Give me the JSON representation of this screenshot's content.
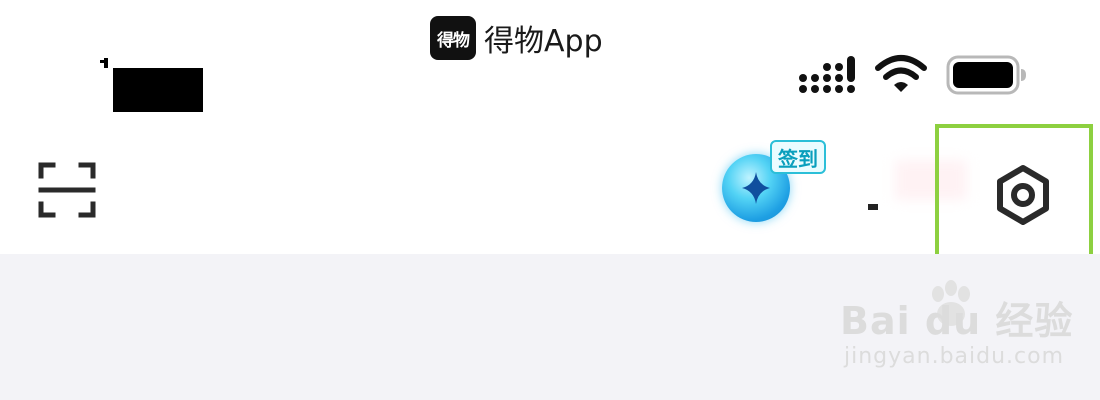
{
  "app_label": {
    "logo_text": "得物",
    "name": "得物App"
  },
  "status_bar": {
    "signal": "signal-icon",
    "wifi": "wifi-icon",
    "battery": "battery-icon"
  },
  "header": {
    "scan": "scan-icon",
    "checkin_label": "签到",
    "settings": "gear-icon"
  },
  "watermark": {
    "brand": "Bai du 经验",
    "url": "jingyan.baidu.com"
  },
  "colors": {
    "highlight": "#8dd040",
    "content_bg": "#f3f3f7",
    "checkin_accent": "#2bbfd8",
    "orb": "#1e9fe3"
  }
}
